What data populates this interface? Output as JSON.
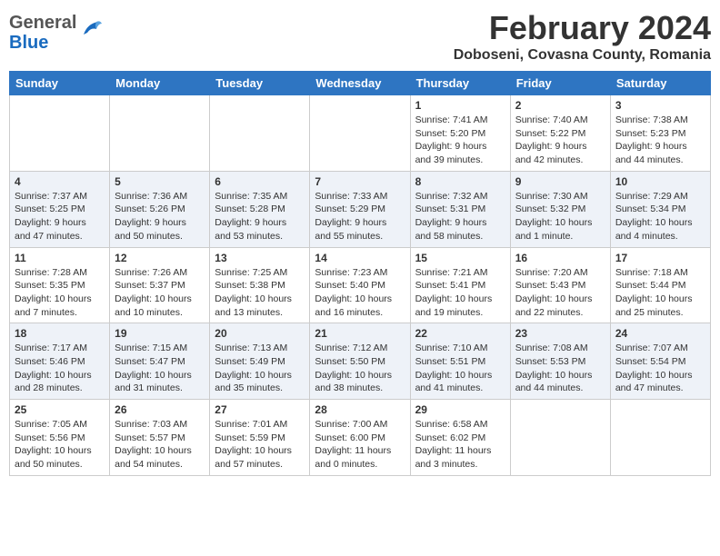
{
  "header": {
    "logo_line1": "General",
    "logo_line2": "Blue",
    "title": "February 2024",
    "location": "Doboseni, Covasna County, Romania"
  },
  "days_of_week": [
    "Sunday",
    "Monday",
    "Tuesday",
    "Wednesday",
    "Thursday",
    "Friday",
    "Saturday"
  ],
  "weeks": [
    [
      {
        "day": "",
        "info": ""
      },
      {
        "day": "",
        "info": ""
      },
      {
        "day": "",
        "info": ""
      },
      {
        "day": "",
        "info": ""
      },
      {
        "day": "1",
        "info": "Sunrise: 7:41 AM\nSunset: 5:20 PM\nDaylight: 9 hours\nand 39 minutes."
      },
      {
        "day": "2",
        "info": "Sunrise: 7:40 AM\nSunset: 5:22 PM\nDaylight: 9 hours\nand 42 minutes."
      },
      {
        "day": "3",
        "info": "Sunrise: 7:38 AM\nSunset: 5:23 PM\nDaylight: 9 hours\nand 44 minutes."
      }
    ],
    [
      {
        "day": "4",
        "info": "Sunrise: 7:37 AM\nSunset: 5:25 PM\nDaylight: 9 hours\nand 47 minutes."
      },
      {
        "day": "5",
        "info": "Sunrise: 7:36 AM\nSunset: 5:26 PM\nDaylight: 9 hours\nand 50 minutes."
      },
      {
        "day": "6",
        "info": "Sunrise: 7:35 AM\nSunset: 5:28 PM\nDaylight: 9 hours\nand 53 minutes."
      },
      {
        "day": "7",
        "info": "Sunrise: 7:33 AM\nSunset: 5:29 PM\nDaylight: 9 hours\nand 55 minutes."
      },
      {
        "day": "8",
        "info": "Sunrise: 7:32 AM\nSunset: 5:31 PM\nDaylight: 9 hours\nand 58 minutes."
      },
      {
        "day": "9",
        "info": "Sunrise: 7:30 AM\nSunset: 5:32 PM\nDaylight: 10 hours\nand 1 minute."
      },
      {
        "day": "10",
        "info": "Sunrise: 7:29 AM\nSunset: 5:34 PM\nDaylight: 10 hours\nand 4 minutes."
      }
    ],
    [
      {
        "day": "11",
        "info": "Sunrise: 7:28 AM\nSunset: 5:35 PM\nDaylight: 10 hours\nand 7 minutes."
      },
      {
        "day": "12",
        "info": "Sunrise: 7:26 AM\nSunset: 5:37 PM\nDaylight: 10 hours\nand 10 minutes."
      },
      {
        "day": "13",
        "info": "Sunrise: 7:25 AM\nSunset: 5:38 PM\nDaylight: 10 hours\nand 13 minutes."
      },
      {
        "day": "14",
        "info": "Sunrise: 7:23 AM\nSunset: 5:40 PM\nDaylight: 10 hours\nand 16 minutes."
      },
      {
        "day": "15",
        "info": "Sunrise: 7:21 AM\nSunset: 5:41 PM\nDaylight: 10 hours\nand 19 minutes."
      },
      {
        "day": "16",
        "info": "Sunrise: 7:20 AM\nSunset: 5:43 PM\nDaylight: 10 hours\nand 22 minutes."
      },
      {
        "day": "17",
        "info": "Sunrise: 7:18 AM\nSunset: 5:44 PM\nDaylight: 10 hours\nand 25 minutes."
      }
    ],
    [
      {
        "day": "18",
        "info": "Sunrise: 7:17 AM\nSunset: 5:46 PM\nDaylight: 10 hours\nand 28 minutes."
      },
      {
        "day": "19",
        "info": "Sunrise: 7:15 AM\nSunset: 5:47 PM\nDaylight: 10 hours\nand 31 minutes."
      },
      {
        "day": "20",
        "info": "Sunrise: 7:13 AM\nSunset: 5:49 PM\nDaylight: 10 hours\nand 35 minutes."
      },
      {
        "day": "21",
        "info": "Sunrise: 7:12 AM\nSunset: 5:50 PM\nDaylight: 10 hours\nand 38 minutes."
      },
      {
        "day": "22",
        "info": "Sunrise: 7:10 AM\nSunset: 5:51 PM\nDaylight: 10 hours\nand 41 minutes."
      },
      {
        "day": "23",
        "info": "Sunrise: 7:08 AM\nSunset: 5:53 PM\nDaylight: 10 hours\nand 44 minutes."
      },
      {
        "day": "24",
        "info": "Sunrise: 7:07 AM\nSunset: 5:54 PM\nDaylight: 10 hours\nand 47 minutes."
      }
    ],
    [
      {
        "day": "25",
        "info": "Sunrise: 7:05 AM\nSunset: 5:56 PM\nDaylight: 10 hours\nand 50 minutes."
      },
      {
        "day": "26",
        "info": "Sunrise: 7:03 AM\nSunset: 5:57 PM\nDaylight: 10 hours\nand 54 minutes."
      },
      {
        "day": "27",
        "info": "Sunrise: 7:01 AM\nSunset: 5:59 PM\nDaylight: 10 hours\nand 57 minutes."
      },
      {
        "day": "28",
        "info": "Sunrise: 7:00 AM\nSunset: 6:00 PM\nDaylight: 11 hours\nand 0 minutes."
      },
      {
        "day": "29",
        "info": "Sunrise: 6:58 AM\nSunset: 6:02 PM\nDaylight: 11 hours\nand 3 minutes."
      },
      {
        "day": "",
        "info": ""
      },
      {
        "day": "",
        "info": ""
      }
    ]
  ]
}
